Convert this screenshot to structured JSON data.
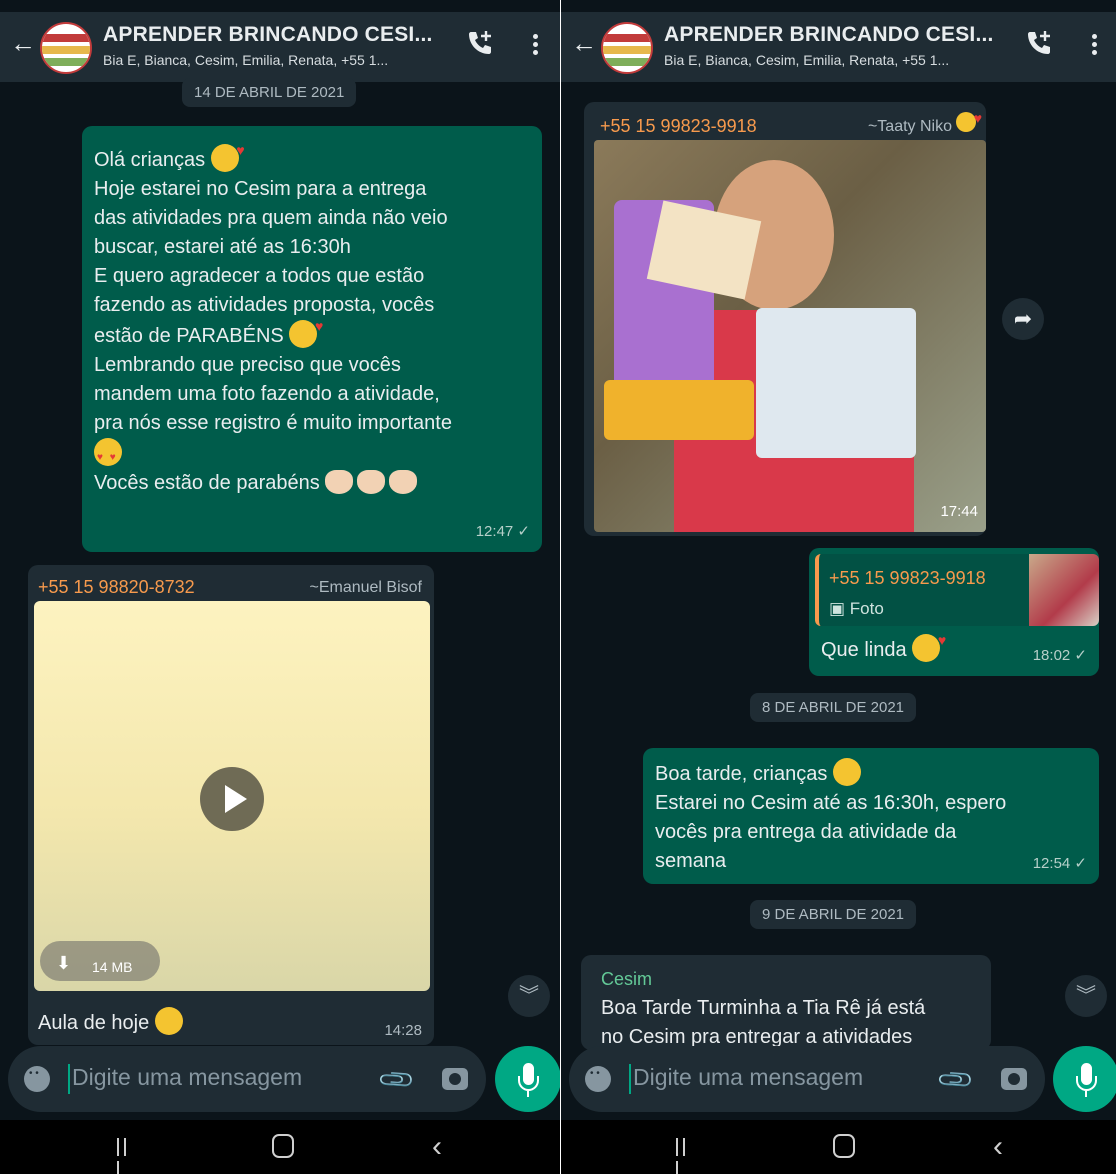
{
  "chat": {
    "title": "APRENDER BRINCANDO CESI...",
    "subtitle": "Bia E, Bianca, Cesim, Emilia, Renata, +55 1...",
    "icons": {
      "back": "arrow-left-icon",
      "call": "add-call-icon",
      "menu": "more-vert-icon"
    }
  },
  "left_panel": {
    "date_chip": "14 DE ABRIL DE 2021",
    "msg1": {
      "lines": [
        "Olá crianças",
        "Hoje estarei no Cesim para a entrega",
        "das atividades pra  quem ainda não veio",
        "buscar,  estarei até as 16:30h",
        "E quero agradecer  a todos que estão",
        "fazendo as atividades proposta, vocês",
        "estão de PARABÉNS",
        "Lembrando que preciso que vocês",
        "mandem uma foto fazendo a atividade,",
        "pra nós esse registro é muito importante",
        "Vocês estão de parabéns"
      ],
      "time": "12:47 ✓"
    },
    "msg2": {
      "sender": "+55 15 98820-8732",
      "pushname": "~Emanuel Bisof",
      "video_size": "14 MB",
      "caption": "Aula de hoje",
      "time": "14:28"
    }
  },
  "right_panel": {
    "msg1": {
      "sender": "+55 15 99823-9918",
      "pushname": "~Taaty Niko",
      "time": "17:44"
    },
    "msg2": {
      "quote_sender": "+55 15 99823-9918",
      "quote_type": "Foto",
      "text": "Que linda",
      "time": "18:02 ✓"
    },
    "date_chip_1": "8 DE ABRIL DE 2021",
    "msg3": {
      "lines": [
        "Boa tarde, crianças",
        "Estarei no Cesim até as 16:30h, espero",
        "vocês pra entrega da atividade da",
        "semana"
      ],
      "time": "12:54 ✓"
    },
    "date_chip_2": "9 DE ABRIL DE 2021",
    "msg4": {
      "sender": "Cesim",
      "lines": [
        "Boa Tarde Turminha a Tia Rê já está",
        "no Cesim pra entregar a atividades"
      ]
    }
  },
  "composer": {
    "placeholder": "Digite uma mensagem"
  },
  "colors": {
    "background": "#0b141a",
    "header": "#1f2c34",
    "outgoing": "#005c4b",
    "incoming": "#1f2c34",
    "accent": "#00a884",
    "sender_orange": "#f79a4d",
    "sender_green": "#63c997"
  }
}
